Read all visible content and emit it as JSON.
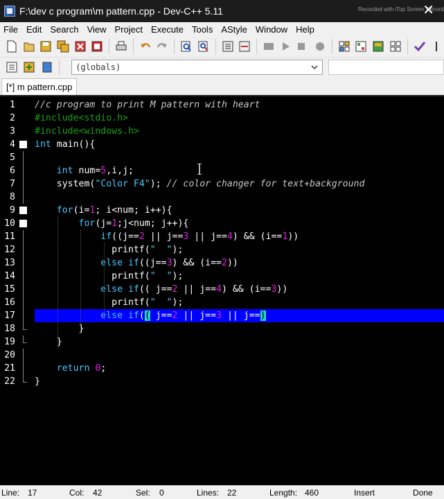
{
  "window": {
    "title": "F:\\dev c program\\m pattern.cpp - Dev-C++ 5.11",
    "watermark": "Recorded with iTop Screen Recorder"
  },
  "menu": [
    "File",
    "Edit",
    "Search",
    "View",
    "Project",
    "Execute",
    "Tools",
    "AStyle",
    "Window",
    "Help"
  ],
  "toolbar": {
    "scope_value": "(globals)"
  },
  "tab": {
    "label": "[*] m pattern.cpp"
  },
  "editor": {
    "lines": [
      {
        "n": "1",
        "tokens": [
          [
            "c-comment",
            "//c program to print M pattern with heart"
          ]
        ]
      },
      {
        "n": "2",
        "tokens": [
          [
            "c-pre",
            "#include<stdio.h>"
          ]
        ]
      },
      {
        "n": "3",
        "tokens": [
          [
            "c-pre",
            "#include<windows.h>"
          ]
        ]
      },
      {
        "n": "4",
        "tokens": [
          [
            "c-kw",
            "int"
          ],
          [
            "c-plain",
            " main(){"
          ]
        ]
      },
      {
        "n": "5",
        "tokens": []
      },
      {
        "n": "6",
        "tokens": [
          [
            "c-plain",
            "    "
          ],
          [
            "c-kw",
            "int"
          ],
          [
            "c-plain",
            " num="
          ],
          [
            "c-num",
            "5"
          ],
          [
            "c-plain",
            ",i,j;"
          ]
        ]
      },
      {
        "n": "7",
        "tokens": [
          [
            "c-plain",
            "    system("
          ],
          [
            "c-str",
            "\"Color F4\""
          ],
          [
            "c-plain",
            "); "
          ],
          [
            "c-comment",
            "// color changer for text+background"
          ]
        ]
      },
      {
        "n": "8",
        "tokens": []
      },
      {
        "n": "9",
        "tokens": [
          [
            "c-plain",
            "    "
          ],
          [
            "c-kw",
            "for"
          ],
          [
            "c-plain",
            "(i="
          ],
          [
            "c-num",
            "1"
          ],
          [
            "c-plain",
            "; i<num; i++){"
          ]
        ]
      },
      {
        "n": "10",
        "tokens": [
          [
            "c-plain",
            "        "
          ],
          [
            "c-kw",
            "for"
          ],
          [
            "c-plain",
            "(j="
          ],
          [
            "c-num",
            "1"
          ],
          [
            "c-plain",
            ";j<num; j++){"
          ]
        ]
      },
      {
        "n": "11",
        "tokens": [
          [
            "c-plain",
            "            "
          ],
          [
            "c-kw",
            "if"
          ],
          [
            "c-plain",
            "((j=="
          ],
          [
            "c-num",
            "2"
          ],
          [
            "c-plain",
            " || j=="
          ],
          [
            "c-num",
            "3"
          ],
          [
            "c-plain",
            " || j=="
          ],
          [
            "c-num",
            "4"
          ],
          [
            "c-plain",
            ") && (i=="
          ],
          [
            "c-num",
            "1"
          ],
          [
            "c-plain",
            "))"
          ]
        ]
      },
      {
        "n": "12",
        "tokens": [
          [
            "c-plain",
            "              printf("
          ],
          [
            "c-str",
            "\"  \""
          ],
          [
            "c-plain",
            ");"
          ]
        ]
      },
      {
        "n": "13",
        "tokens": [
          [
            "c-plain",
            "            "
          ],
          [
            "c-kw",
            "else if"
          ],
          [
            "c-plain",
            "((j=="
          ],
          [
            "c-num",
            "3"
          ],
          [
            "c-plain",
            ") && (i=="
          ],
          [
            "c-num",
            "2"
          ],
          [
            "c-plain",
            "))"
          ]
        ]
      },
      {
        "n": "14",
        "tokens": [
          [
            "c-plain",
            "              printf("
          ],
          [
            "c-str",
            "\"  \""
          ],
          [
            "c-plain",
            ");"
          ]
        ]
      },
      {
        "n": "15",
        "tokens": [
          [
            "c-plain",
            "            "
          ],
          [
            "c-kw",
            "else if"
          ],
          [
            "c-plain",
            "(( j=="
          ],
          [
            "c-num",
            "2"
          ],
          [
            "c-plain",
            " || j=="
          ],
          [
            "c-num",
            "4"
          ],
          [
            "c-plain",
            ") && (i=="
          ],
          [
            "c-num",
            "3"
          ],
          [
            "c-plain",
            "))"
          ]
        ]
      },
      {
        "n": "16",
        "tokens": [
          [
            "c-plain",
            "              printf("
          ],
          [
            "c-str",
            "\"  \""
          ],
          [
            "c-plain",
            ");"
          ]
        ]
      },
      {
        "n": "17",
        "tokens": [
          [
            "c-plain",
            "            "
          ],
          [
            "c-kw",
            "else if"
          ],
          [
            "c-plain",
            "("
          ],
          [
            "c-cur",
            "("
          ],
          [
            "c-plain",
            " j=="
          ],
          [
            "c-num",
            "2"
          ],
          [
            "c-plain",
            " || j=="
          ],
          [
            "c-num",
            "3"
          ],
          [
            "c-plain",
            " || j=="
          ],
          [
            "c-cur",
            ")"
          ]
        ]
      },
      {
        "n": "18",
        "tokens": [
          [
            "c-plain",
            "        }"
          ]
        ]
      },
      {
        "n": "19",
        "tokens": [
          [
            "c-plain",
            "    }"
          ]
        ]
      },
      {
        "n": "20",
        "tokens": []
      },
      {
        "n": "21",
        "tokens": [
          [
            "c-plain",
            "    "
          ],
          [
            "c-kw",
            "return"
          ],
          [
            "c-plain",
            " "
          ],
          [
            "c-num",
            "0"
          ],
          [
            "c-plain",
            ";"
          ]
        ]
      },
      {
        "n": "22",
        "tokens": [
          [
            "c-plain",
            "}"
          ]
        ]
      }
    ],
    "highlight_line": "17"
  },
  "status": {
    "line_label": "Line:",
    "line_value": "17",
    "col_label": "Col:",
    "col_value": "42",
    "sel_label": "Sel:",
    "sel_value": "0",
    "lines_label": "Lines:",
    "lines_value": "22",
    "length_label": "Length:",
    "length_value": "460",
    "mode": "Insert",
    "state": "Done"
  }
}
